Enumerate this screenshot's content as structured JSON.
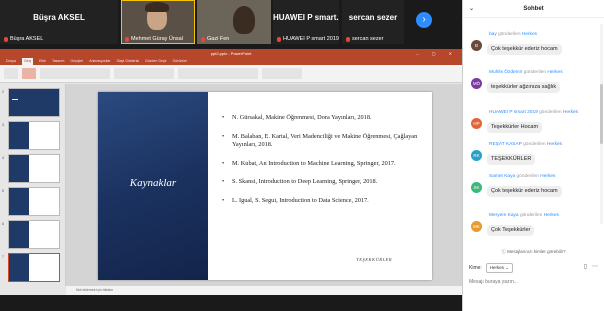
{
  "participants": [
    {
      "big_name": "Büşra AKSEL",
      "caption": "Büşra AKSEL"
    },
    {
      "big_name": "",
      "caption": "Mehmet Güray Ünsal",
      "active": true
    },
    {
      "big_name": "",
      "caption": "Gazi Fen"
    },
    {
      "big_name": "HUAWEI P smart...",
      "caption": "HUAWEI P smart 2019"
    },
    {
      "big_name": "sercan sezer",
      "caption": "sercan sezer"
    }
  ],
  "ppt": {
    "title": "ppt2.pptx - PowerPoint",
    "tabs": [
      "Dosya",
      "Giriş",
      "Ekle",
      "Tasarım",
      "Geçişler",
      "Animasyonlar",
      "Slayt Gösterisi",
      "Gözden Geçir",
      "Görünüm"
    ],
    "thumb_numbers": [
      "2",
      "3",
      "4",
      "5",
      "6",
      "7"
    ],
    "slide": {
      "title": "Kaynaklar",
      "references": [
        "N. Gürsakal, Makine Öğrenmesi, Dora Yayınları, 2018.",
        "M. Balaban, E. Kartal, Veri Madenciliği ve Makine Öğrenmesi, Çağlayan Yayınları, 2018.",
        "M. Kubat, An Introduction to Machine Learning, Springer, 2017.",
        "S. Skansi, Introduction to Deep Learning, Springer, 2018.",
        "L. Igual, S. Segui, Introduction to Data Science, 2017."
      ],
      "signature": "TEŞEKKÜRLER"
    },
    "notes_text": "Not eklemek için tıklatın"
  },
  "chat": {
    "title": "Sohbet",
    "messages": [
      {
        "sender": "bay",
        "to": "Herkes",
        "text": "Çok teşekkür ederiz hocam",
        "initials": "B",
        "color": "#6a4a3a"
      },
      {
        "sender": "Muhlis Özdemir",
        "to": "Herkes",
        "text": "teşekkürler ağzınıza sağlık",
        "initials": "MÖ",
        "color": "#7a3aa0"
      },
      {
        "sender": "HUAWEI P smart 2019",
        "to": "Herkes",
        "text": "Teşekkürler Hocam",
        "initials": "HP",
        "color": "#e0663a"
      },
      {
        "sender": "REŞAT KASAP",
        "to": "Herkes",
        "text": "TEŞEKKÜRLER",
        "initials": "RK",
        "color": "#2aa0c8"
      },
      {
        "sender": "Samet Kaya",
        "to": "Herkes",
        "text": "Çok teşekkür ederiz hocam",
        "initials": "SK",
        "color": "#3cb878"
      },
      {
        "sender": "Meryem Kaya",
        "to": "Herkes",
        "text": "Çok Teşekkürler",
        "initials": "MK",
        "color": "#e89a2a"
      }
    ],
    "sent_label": "gönderilen",
    "visibility_note": "Mesajlarınızı kimler görebilir?",
    "recipient_label": "Kime:",
    "recipient_value": "Herkes",
    "input_placeholder": "Mesajı buraya yazın..."
  }
}
